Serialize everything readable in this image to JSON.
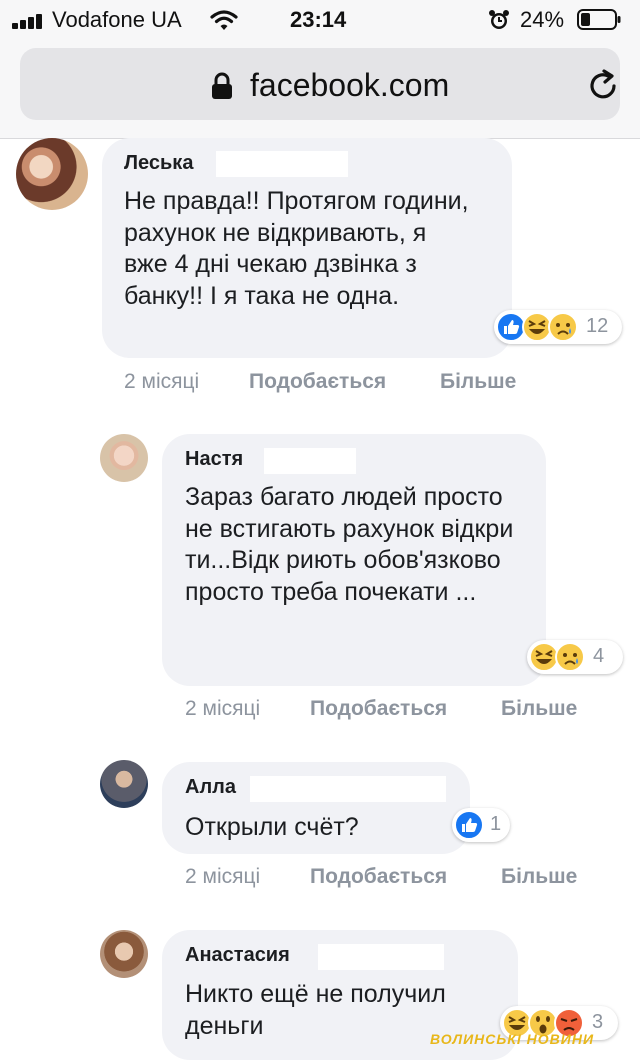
{
  "status_bar": {
    "carrier": "Vodafone UA",
    "time": "23:14",
    "battery": "24%"
  },
  "browser": {
    "url": "facebook.com"
  },
  "comments": [
    {
      "author": "Леська",
      "text": "Не правда!! Протягом години, рахунок не відкривають, я вже 4 дні чекаю дзвінка з банку!! І я така не одна.",
      "reactions": [
        "like",
        "haha",
        "sad"
      ],
      "reaction_count": "12",
      "time": "2 місяці",
      "like_label": "Подобається",
      "more_label": "Більше"
    },
    {
      "author": "Настя",
      "text": "Зараз багато людей просто не встигають рахунок відкрити...Відк риють обов'язково просто треба почекати ...",
      "reactions": [
        "haha",
        "sad"
      ],
      "reaction_count": "4",
      "time": "2 місяці",
      "like_label": "Подобається",
      "more_label": "Більше"
    },
    {
      "author": "Алла",
      "text": "Открыли счёт?",
      "reactions": [
        "like"
      ],
      "reaction_count": "1",
      "time": "2 місяці",
      "like_label": "Подобається",
      "more_label": "Більше"
    },
    {
      "author": "Анастасия",
      "text": "Никто ещё не получил деньги",
      "reactions": [
        "haha",
        "wow",
        "angry"
      ],
      "reaction_count": "3"
    }
  ],
  "watermark": "ВОЛИНСЬКІ НОВИНИ",
  "colors": {
    "like_blue": "#1877f2",
    "emoji_yellow": "#f7c948",
    "meta_gray": "#8d949e",
    "bubble_bg": "#f1f2f6"
  }
}
